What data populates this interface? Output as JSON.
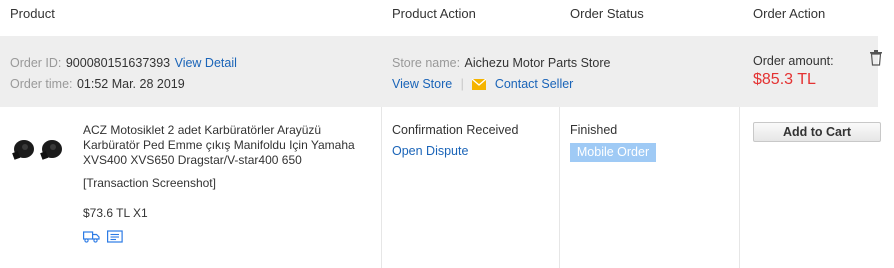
{
  "table_header": {
    "product": "Product",
    "product_action": "Product Action",
    "order_status": "Order Status",
    "order_action": "Order Action"
  },
  "order": {
    "id_label": "Order ID:",
    "id_value": "900080151637393",
    "view_detail": "View Detail",
    "time_label": "Order time:",
    "time_value": "01:52 Mar. 28 2019",
    "store_label": "Store name:",
    "store_name": "Aichezu Motor Parts Store",
    "view_store": "View Store",
    "divider": "|",
    "contact_seller": "Contact Seller",
    "amount_label": "Order amount:",
    "amount_value": "$85.3 TL"
  },
  "item": {
    "title_line1": "ACZ Motosiklet 2 adet Karbüratörler Arayüzü",
    "title_line2": "Karbüratör Ped Emme çıkış Manifoldu Için Yamaha",
    "title_line3": "XVS400 XVS650 Dragstar/V-star400 650",
    "transaction_screenshot": "[Transaction Screenshot]",
    "price_qty": "$73.6 TL X1",
    "product_status": "Confirmation Received",
    "open_dispute": "Open Dispute",
    "order_status": "Finished",
    "mobile_badge": "Mobile Order",
    "add_to_cart": "Add to Cart"
  },
  "colors": {
    "link": "#1a64b8",
    "amount": "#e43232",
    "badge": "#9fcaf5",
    "band": "#eeeeee",
    "mail_icon": "#f5b400"
  },
  "icons": [
    "shipping-truck-icon",
    "receipt-icon",
    "mail-icon",
    "trash-icon"
  ]
}
